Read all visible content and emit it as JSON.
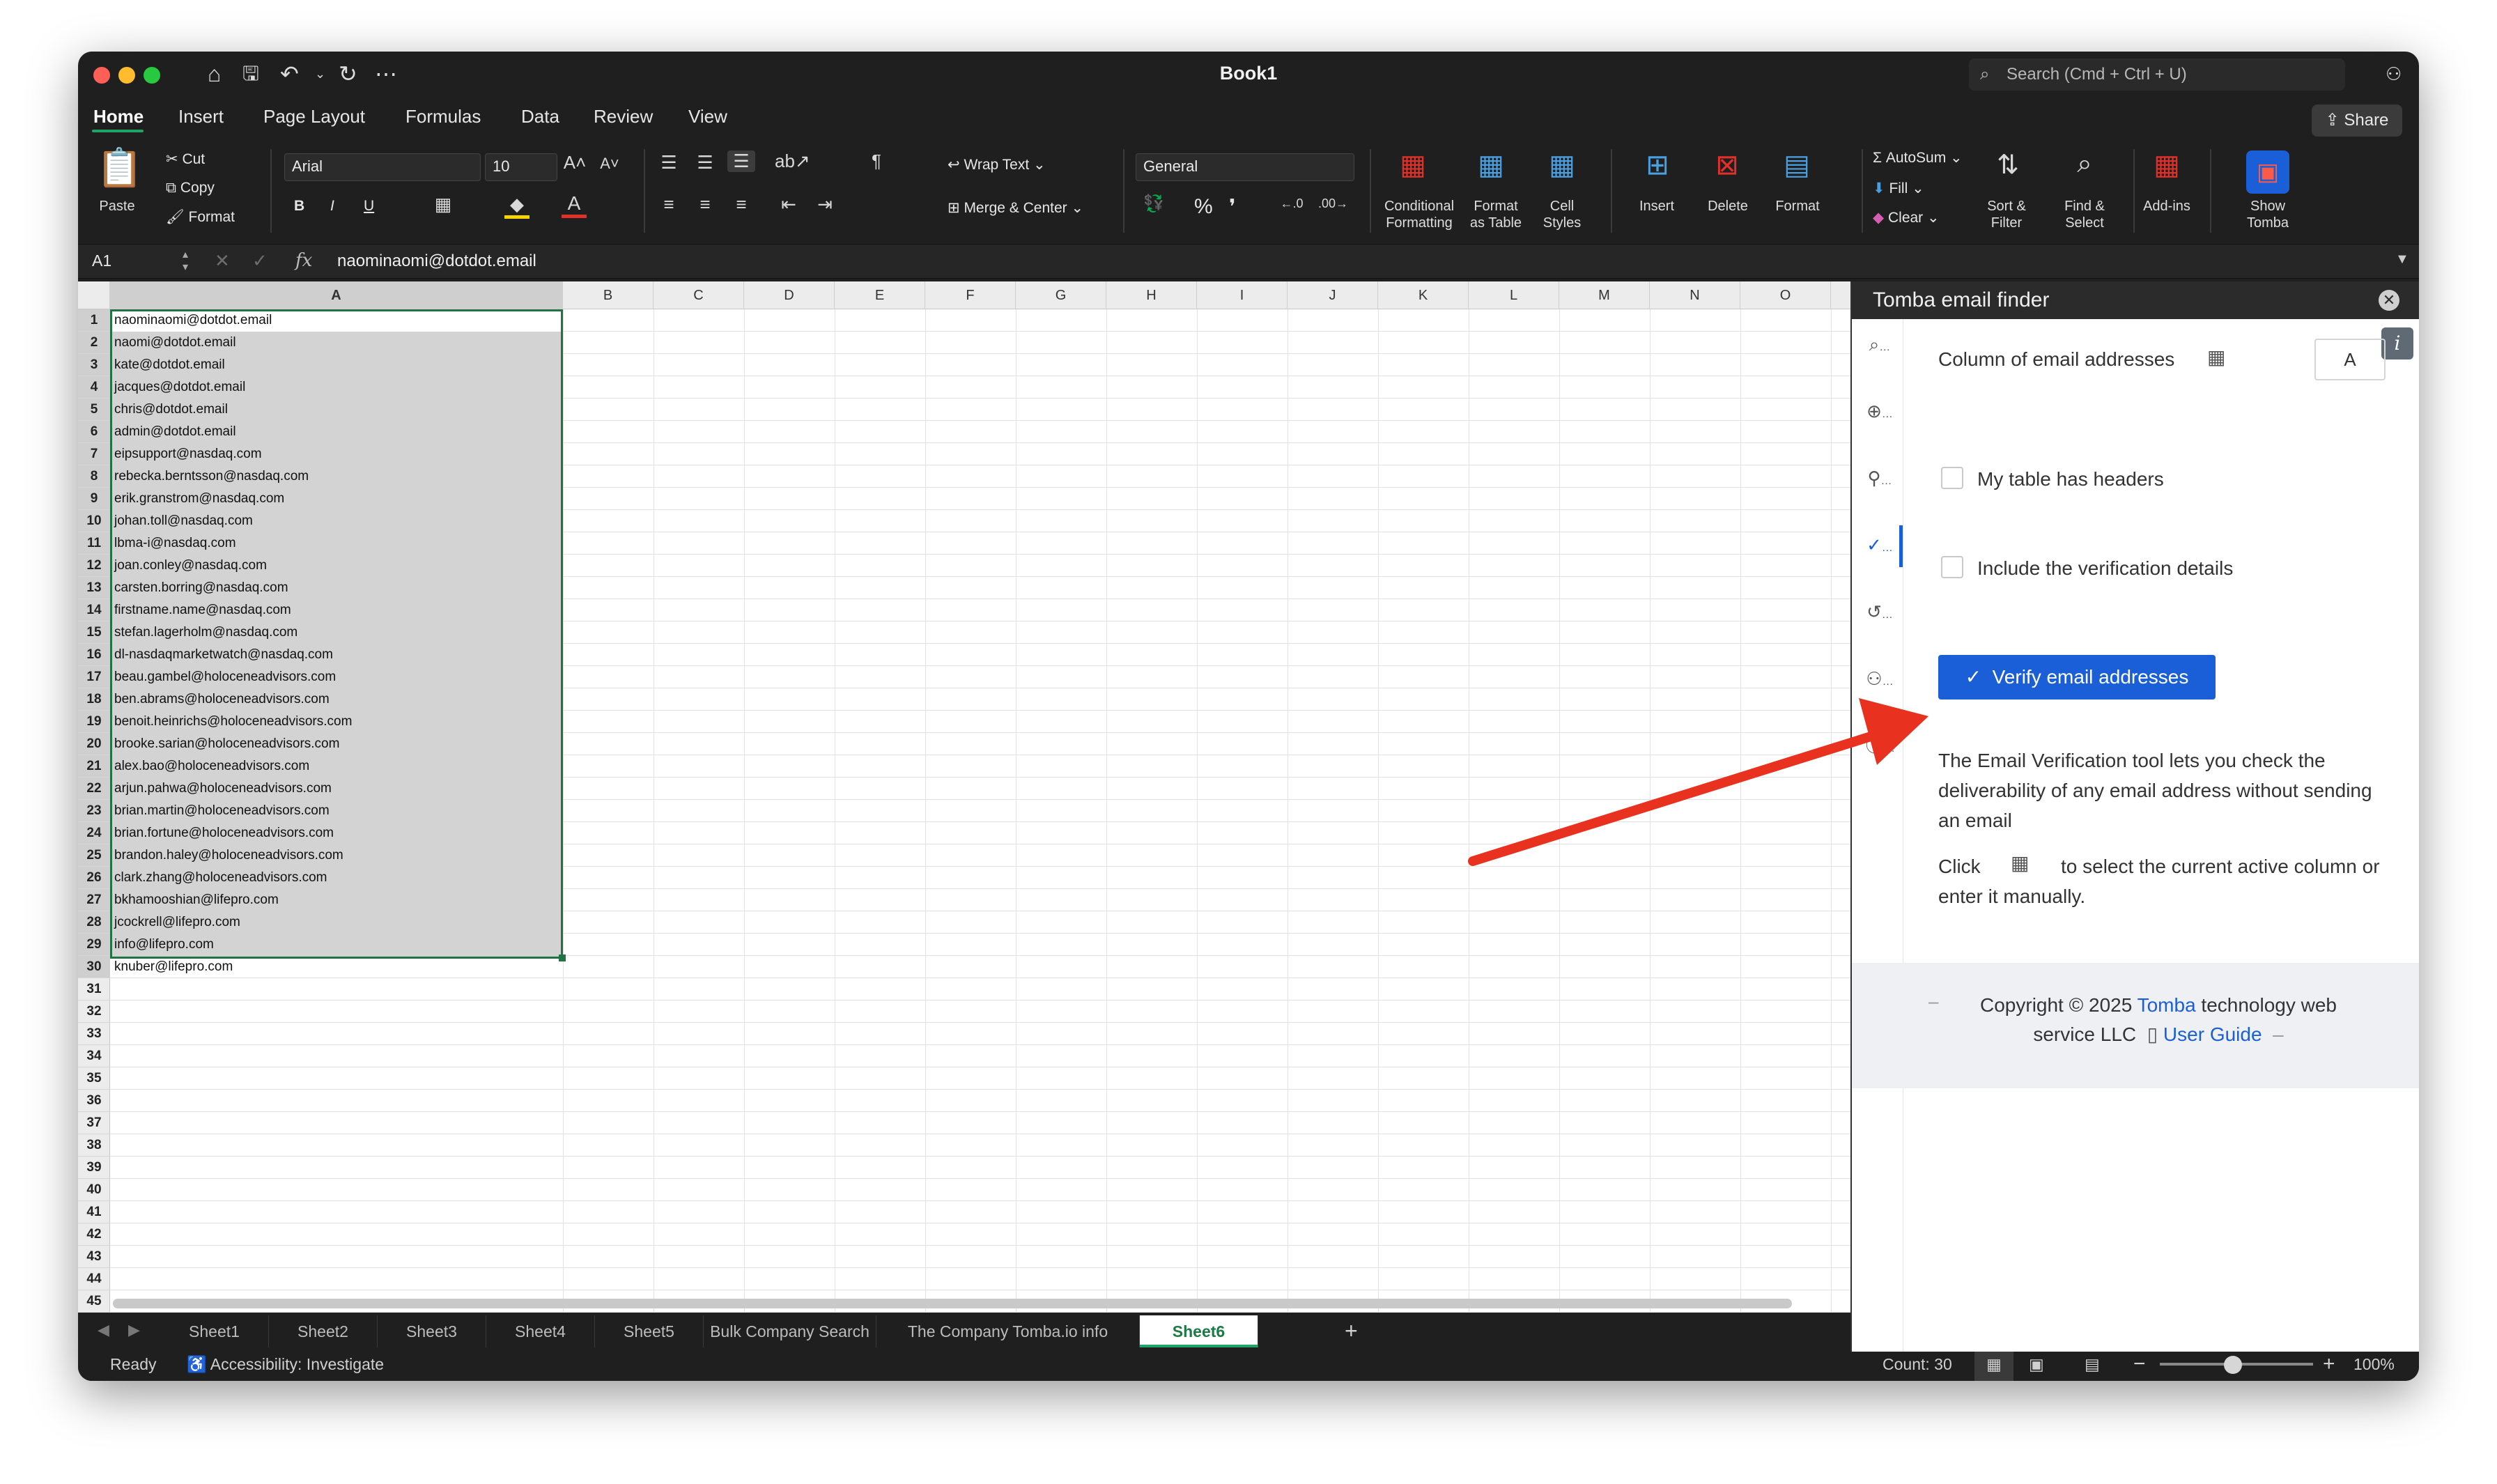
{
  "window": {
    "title": "Book1",
    "search_placeholder": "Search (Cmd + Ctrl + U)",
    "share_label": "Share"
  },
  "menu_tabs": [
    "Home",
    "Insert",
    "Page Layout",
    "Formulas",
    "Data",
    "Review",
    "View"
  ],
  "ribbon": {
    "clipboard": {
      "paste": "Paste",
      "cut": "Cut",
      "copy": "Copy",
      "format": "Format"
    },
    "font": {
      "name": "Arial",
      "size": "10",
      "bold": "B",
      "italic": "I",
      "underline": "U"
    },
    "alignment": {
      "wrap_text": "Wrap Text",
      "merge_center": "Merge & Center"
    },
    "number": {
      "format": "General",
      "percent": "%",
      "comma": "❜"
    },
    "styles": {
      "conditional_formatting": "Conditional\nFormatting",
      "format_as_table": "Format\nas Table",
      "cell_styles": "Cell\nStyles"
    },
    "cells": {
      "insert": "Insert",
      "delete": "Delete",
      "format": "Format"
    },
    "editing": {
      "autosum": "AutoSum",
      "fill": "Fill",
      "clear": "Clear",
      "sort_filter": "Sort &\nFilter",
      "find_select": "Find &\nSelect"
    },
    "addins": "Add-ins",
    "show_tomba": "Show\nTomba"
  },
  "formula_bar": {
    "name_box": "A1",
    "fx": "fx",
    "value": "naominaomi@dotdot.email"
  },
  "columns": [
    "A",
    "B",
    "C",
    "D",
    "E",
    "F",
    "G",
    "H",
    "I",
    "J",
    "K",
    "L",
    "M",
    "N",
    "O"
  ],
  "rows": [
    "1",
    "2",
    "3",
    "4",
    "5",
    "6",
    "7",
    "8",
    "9",
    "10",
    "11",
    "12",
    "13",
    "14",
    "15",
    "16",
    "17",
    "18",
    "19",
    "20",
    "21",
    "22",
    "23",
    "24",
    "25",
    "26",
    "27",
    "28",
    "29",
    "30",
    "31",
    "32",
    "33",
    "34",
    "35",
    "36",
    "37",
    "38",
    "39",
    "40",
    "41",
    "42",
    "43",
    "44",
    "45"
  ],
  "emails": [
    "naominaomi@dotdot.email",
    "naomi@dotdot.email",
    "kate@dotdot.email",
    "jacques@dotdot.email",
    "chris@dotdot.email",
    "admin@dotdot.email",
    "eipsupport@nasdaq.com",
    "rebecka.berntsson@nasdaq.com",
    "erik.granstrom@nasdaq.com",
    "johan.toll@nasdaq.com",
    "lbma-i@nasdaq.com",
    "joan.conley@nasdaq.com",
    "carsten.borring@nasdaq.com",
    "firstname.name@nasdaq.com",
    "stefan.lagerholm@nasdaq.com",
    "dl-nasdaqmarketwatch@nasdaq.com",
    "beau.gambel@holoceneadvisors.com",
    "ben.abrams@holoceneadvisors.com",
    "benoit.heinrichs@holoceneadvisors.com",
    "brooke.sarian@holoceneadvisors.com",
    "alex.bao@holoceneadvisors.com",
    "arjun.pahwa@holoceneadvisors.com",
    "brian.martin@holoceneadvisors.com",
    "brian.fortune@holoceneadvisors.com",
    "brandon.haley@holoceneadvisors.com",
    "clark.zhang@holoceneadvisors.com",
    "bkhamooshian@lifepro.com",
    "jcockrell@lifepro.com",
    "info@lifepro.com",
    "knuber@lifepro.com"
  ],
  "panel": {
    "title": "Tomba email finder",
    "column_label": "Column of email addresses",
    "column_value": "A",
    "headers_label": "My table has headers",
    "details_label": "Include the verification details",
    "verify_button": "Verify email addresses",
    "description": "The Email Verification tool lets you check the deliverability of any email address without sending an email",
    "hint_click": "Click",
    "hint_rest": "to select the current active column or enter it manually.",
    "footer_copyright": "Copyright © 2025",
    "footer_brand": "Tomba",
    "footer_rest": "technology web service LLC",
    "footer_guide": "User Guide",
    "info_badge": "i",
    "rail_icons": [
      "search-icon",
      "globe-icon",
      "person-search-icon",
      "check-icon",
      "history-icon",
      "account-icon",
      "info-icon"
    ],
    "rail_labels": [
      "…",
      "…",
      "…",
      "…",
      "…",
      "…",
      "…"
    ]
  },
  "sheet_tabs": [
    "Sheet1",
    "Sheet2",
    "Sheet3",
    "Sheet4",
    "Sheet5",
    "Bulk Company Search",
    "The Company Tomba.io info",
    "Sheet6"
  ],
  "active_sheet": "Sheet6",
  "status": {
    "ready": "Ready",
    "accessibility": "Accessibility: Investigate",
    "count": "Count: 30",
    "zoom": "100%"
  },
  "colors": {
    "excel_green": "#21a366",
    "verify_blue": "#1a5fd8",
    "arrow_red": "#e8321f"
  }
}
